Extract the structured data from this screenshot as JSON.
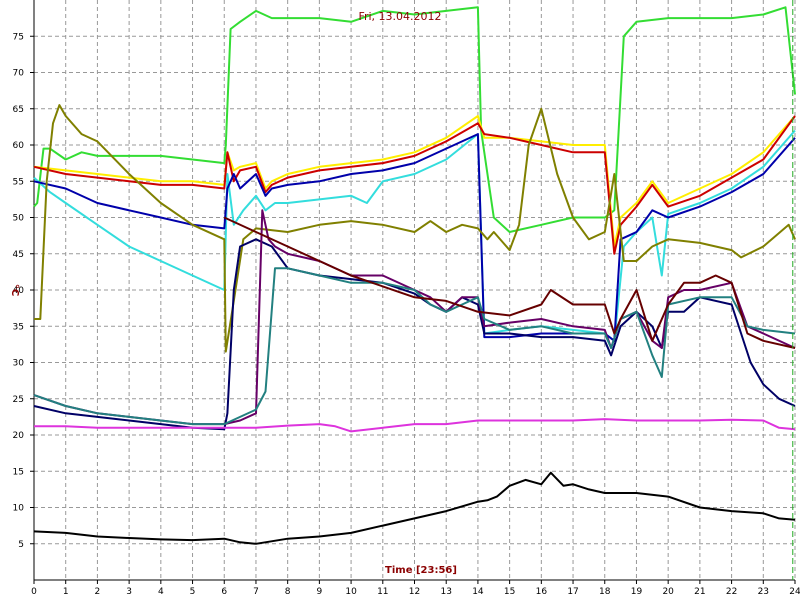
{
  "chart_data": {
    "type": "line",
    "title": "Fri, 13.04.2012",
    "xlabel": "Time [23:56]",
    "ylabel": "°C",
    "xlim": [
      0,
      24
    ],
    "ylim": [
      0,
      80
    ],
    "xticks": [
      0,
      1,
      2,
      3,
      4,
      5,
      6,
      7,
      8,
      9,
      10,
      11,
      12,
      13,
      14,
      15,
      16,
      17,
      18,
      19,
      20,
      21,
      22,
      23,
      24
    ],
    "yticks": [
      5,
      10,
      15,
      20,
      25,
      30,
      35,
      40,
      45,
      50,
      55,
      60,
      65,
      70,
      75
    ],
    "grid": true,
    "colors": {
      "background": "#ffffff",
      "grid": "#999999",
      "title": "#8b0000",
      "cursor": "#22aa22"
    },
    "cursor_x": 23.93,
    "series": [
      {
        "color": "#33dd33",
        "x": [
          0,
          0.1,
          0.3,
          0.5,
          1,
          1.5,
          2,
          3,
          4,
          5,
          6,
          6.05,
          6.2,
          6.5,
          7,
          7.5,
          8,
          9,
          10,
          11,
          12,
          13,
          14,
          14.1,
          14.5,
          15,
          16,
          17,
          18,
          18.3,
          18.6,
          19,
          20,
          21,
          22,
          23,
          23.7,
          24
        ],
        "y": [
          51.5,
          52,
          59.5,
          59.5,
          58,
          59,
          58.5,
          58.5,
          58.5,
          58,
          57.5,
          60,
          76,
          77,
          78.5,
          77.5,
          77.5,
          77.5,
          77,
          78.5,
          78,
          78.5,
          79,
          62,
          50,
          48,
          49,
          50,
          50,
          51,
          75,
          77,
          77.5,
          77.5,
          77.5,
          78,
          79,
          67
        ]
      },
      {
        "color": "#ffee00",
        "x": [
          0,
          1,
          2,
          3,
          4,
          5,
          6,
          6.1,
          6.3,
          6.5,
          7,
          7.3,
          7.5,
          8,
          9,
          10,
          11,
          12,
          13,
          14,
          14.2,
          15,
          16,
          17,
          18,
          18.3,
          18.5,
          19,
          19.5,
          20,
          21,
          22,
          23,
          24
        ],
        "y": [
          57,
          56.5,
          56,
          55.5,
          55,
          55,
          54.5,
          59,
          56.5,
          57,
          57.5,
          54,
          55,
          56,
          57,
          57.5,
          58,
          59,
          61,
          64,
          61,
          61,
          60.5,
          60,
          60,
          46,
          50,
          52,
          55,
          52,
          54,
          56,
          59,
          64
        ]
      },
      {
        "color": "#cc0000",
        "x": [
          0,
          1,
          2,
          3,
          4,
          5,
          6,
          6.1,
          6.3,
          6.5,
          7,
          7.3,
          7.5,
          8,
          9,
          10,
          11,
          12,
          13,
          14,
          14.2,
          15,
          16,
          17,
          18,
          18.3,
          18.5,
          19,
          19.5,
          20,
          21,
          22,
          23,
          24
        ],
        "y": [
          57,
          56,
          55.5,
          55,
          54.5,
          54.5,
          54,
          59,
          55,
          56.5,
          57,
          53.5,
          54.5,
          55.5,
          56.5,
          57,
          57.5,
          58.5,
          60.5,
          63,
          61.5,
          61,
          60,
          59,
          59,
          45,
          49,
          51.5,
          54.5,
          51.5,
          53,
          55.5,
          58,
          64
        ]
      },
      {
        "color": "#33dddd",
        "x": [
          0,
          0.5,
          1,
          2,
          3,
          4,
          5,
          6,
          6.1,
          6.3,
          6.6,
          7,
          7.3,
          7.6,
          8,
          9,
          10,
          10.5,
          11,
          12,
          13,
          14,
          14.2,
          15,
          16,
          17,
          18,
          18.3,
          18.6,
          19,
          19.5,
          19.8,
          20,
          21,
          22,
          23,
          24
        ],
        "y": [
          55.5,
          53.5,
          52,
          49,
          46,
          44,
          42,
          40,
          56,
          49,
          51,
          53,
          51,
          52,
          52,
          52.5,
          53,
          52,
          55,
          56,
          58,
          61.5,
          34,
          34.5,
          35,
          34.5,
          34,
          33,
          46,
          48,
          50,
          42,
          50.5,
          52,
          54,
          57,
          62
        ]
      },
      {
        "color": "#0000aa",
        "x": [
          0,
          1,
          2,
          3,
          4,
          5,
          6,
          6.1,
          6.3,
          6.5,
          7,
          7.3,
          7.5,
          8,
          9,
          10,
          11,
          12,
          13,
          14,
          14.2,
          15,
          16,
          17,
          18,
          18.3,
          18.5,
          19,
          19.5,
          20,
          21,
          22,
          23,
          24
        ],
        "y": [
          55,
          54,
          52,
          51,
          50,
          49,
          48.5,
          54,
          56,
          54,
          56,
          53,
          54,
          54.5,
          55,
          56,
          56.5,
          57.5,
          59.5,
          61.5,
          33.5,
          33.5,
          34,
          34,
          34,
          33,
          47,
          48,
          51,
          50,
          51.5,
          53.5,
          56,
          61
        ]
      },
      {
        "color": "#808000",
        "x": [
          0,
          0.2,
          0.4,
          0.6,
          0.8,
          1,
          1.5,
          2,
          3,
          4,
          5,
          6,
          6.05,
          6.3,
          6.6,
          7,
          8,
          9,
          10,
          11,
          12,
          12.5,
          13,
          13.5,
          14,
          14.3,
          14.5,
          14.8,
          15,
          15.3,
          15.6,
          16,
          16.5,
          17,
          17.5,
          18,
          18.3,
          18.6,
          19,
          19.5,
          20,
          21,
          22,
          22.3,
          23,
          23.8,
          24
        ],
        "y": [
          36,
          36,
          55,
          63,
          65.5,
          64,
          61.5,
          60.5,
          56,
          52,
          49,
          47,
          31.5,
          38.5,
          47,
          48.5,
          48,
          49,
          49.5,
          49,
          48,
          49.5,
          48,
          49,
          48.5,
          47,
          48,
          46.5,
          45.5,
          49,
          60,
          65,
          56,
          50,
          47,
          48,
          56,
          44,
          44,
          46,
          47,
          46.5,
          45.5,
          44.5,
          46,
          49,
          47
        ]
      },
      {
        "color": "#000066",
        "x": [
          0,
          1,
          2,
          3,
          4,
          5,
          6,
          6.1,
          6.3,
          6.5,
          7,
          7.5,
          8,
          9,
          10,
          11,
          12,
          12.5,
          13,
          13.5,
          14,
          14.2,
          15,
          16,
          17,
          18,
          18.2,
          18.5,
          19,
          19.5,
          19.8,
          20,
          20.5,
          21,
          22,
          22.3,
          22.6,
          23,
          23.5,
          24
        ],
        "y": [
          24,
          23,
          22.5,
          22,
          21.5,
          21,
          20.8,
          23,
          40,
          46,
          47,
          46,
          43,
          42,
          41.5,
          41,
          39.5,
          38,
          37,
          39,
          38,
          34,
          34,
          33.5,
          33.5,
          33,
          31,
          35,
          37,
          35,
          32,
          37,
          37,
          39,
          38,
          34,
          30,
          27,
          25,
          24
        ]
      },
      {
        "color": "#660066",
        "x": [
          0,
          1,
          2,
          3,
          4,
          5,
          6,
          6.5,
          7,
          7.2,
          7.4,
          7.6,
          8,
          9,
          10,
          11,
          12,
          12.5,
          13,
          13.5,
          14,
          14.2,
          15,
          16,
          17,
          18,
          18.2,
          18.5,
          19,
          19.5,
          19.8,
          20,
          20.5,
          21,
          22,
          22.5,
          23,
          24
        ],
        "y": [
          25.5,
          24,
          23,
          22.5,
          22,
          21.5,
          21.5,
          22,
          23,
          51,
          47,
          46,
          45,
          44,
          42,
          42,
          40,
          39,
          37,
          39,
          39,
          35,
          35.5,
          36,
          35,
          34.5,
          32,
          36,
          37,
          33,
          32,
          39,
          40,
          40,
          41,
          35,
          34,
          32
        ]
      },
      {
        "color": "#228080",
        "x": [
          0,
          1,
          2,
          3,
          4,
          5,
          6,
          6.5,
          7,
          7.3,
          7.6,
          8,
          9,
          10,
          11,
          12,
          12.5,
          13,
          13.5,
          14,
          14.2,
          15,
          16,
          17,
          18,
          18.2,
          18.5,
          19,
          19.5,
          19.8,
          20,
          21,
          22,
          22.5,
          23,
          24
        ],
        "y": [
          25.5,
          24,
          23,
          22.5,
          22,
          21.5,
          21.5,
          22.5,
          23.5,
          26,
          43,
          43,
          42,
          41,
          41,
          40,
          38,
          37,
          38,
          39,
          36,
          34.5,
          35,
          34,
          34,
          32,
          36,
          37,
          31,
          28,
          38,
          39,
          39,
          35,
          34.5,
          34
        ]
      },
      {
        "color": "#660000",
        "x": [
          6,
          7,
          8,
          9,
          10,
          11,
          12,
          13,
          14,
          15,
          16,
          16.3,
          17,
          18,
          18.3,
          18.5,
          19,
          19.5,
          20,
          20.5,
          21,
          21.5,
          22,
          22.5,
          23,
          24
        ],
        "y": [
          50,
          48,
          46,
          44,
          42,
          40.5,
          39,
          38.5,
          37,
          36.5,
          38,
          40,
          38,
          38,
          34,
          36,
          40,
          33,
          38,
          41,
          41,
          42,
          41,
          34,
          33,
          32
        ]
      },
      {
        "color": "#dd33dd",
        "x": [
          0,
          1,
          2,
          3,
          4,
          5,
          6,
          7,
          8,
          9,
          9.5,
          10,
          11,
          12,
          13,
          14,
          15,
          16,
          17,
          18,
          19,
          20,
          21,
          22,
          23,
          23.5,
          24
        ],
        "y": [
          21.2,
          21.2,
          21,
          21,
          21,
          21,
          21,
          21,
          21.3,
          21.5,
          21.2,
          20.5,
          21,
          21.5,
          21.5,
          22,
          22,
          22,
          22,
          22.2,
          22,
          22,
          22,
          22.1,
          22,
          21,
          20.8
        ]
      },
      {
        "color": "#000000",
        "x": [
          0,
          1,
          2,
          3,
          4,
          5,
          6,
          6.5,
          7,
          8,
          9,
          10,
          11,
          12,
          13,
          14,
          14.3,
          14.6,
          15,
          15.5,
          16,
          16.3,
          16.7,
          17,
          17.5,
          18,
          19,
          20,
          21,
          22,
          23,
          23.5,
          24
        ],
        "y": [
          6.7,
          6.5,
          6,
          5.8,
          5.6,
          5.5,
          5.7,
          5.2,
          5,
          5.7,
          6,
          6.5,
          7.5,
          8.5,
          9.5,
          10.8,
          11,
          11.5,
          13,
          13.8,
          13.2,
          14.8,
          13,
          13.2,
          12.5,
          12,
          12,
          11.5,
          10,
          9.5,
          9.2,
          8.5,
          8.3
        ]
      }
    ]
  }
}
